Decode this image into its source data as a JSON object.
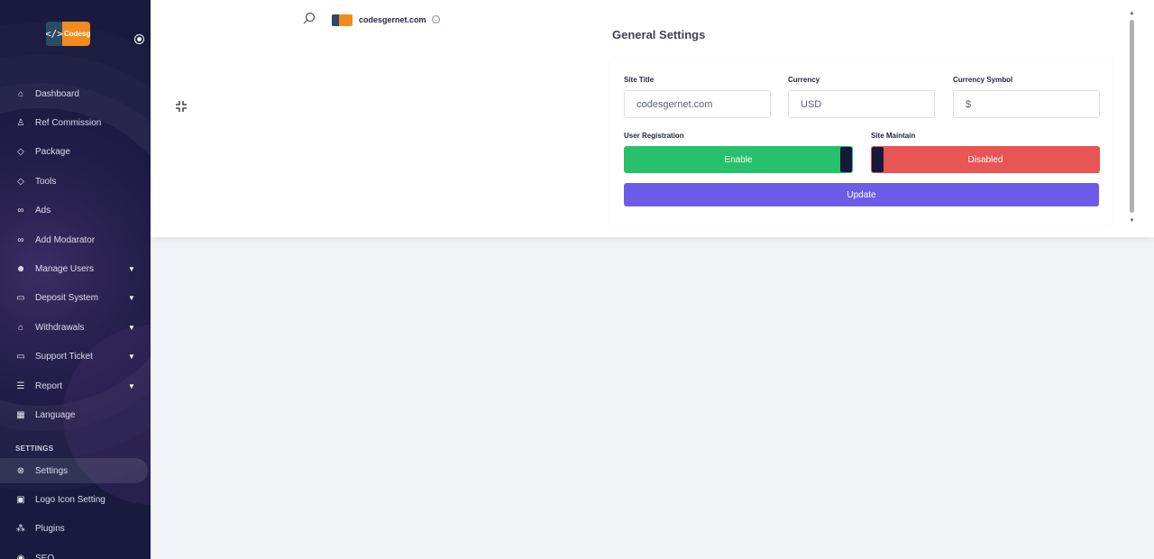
{
  "brand": {
    "logo_text": "Codesger",
    "logo_mark": "</>"
  },
  "sidebar": {
    "items": [
      {
        "label": "Dashboard",
        "icon": "home-icon",
        "glyph": "⌂",
        "has_submenu": false
      },
      {
        "label": "Ref Commission",
        "icon": "bell-icon",
        "glyph": "♙",
        "has_submenu": false
      },
      {
        "label": "Package",
        "icon": "tag-icon",
        "glyph": "◇",
        "has_submenu": false
      },
      {
        "label": "Tools",
        "icon": "tag-icon",
        "glyph": "◇",
        "has_submenu": false
      },
      {
        "label": "Ads",
        "icon": "link-icon",
        "glyph": "∞",
        "has_submenu": false
      },
      {
        "label": "Add Modarator",
        "icon": "link-icon",
        "glyph": "∞",
        "has_submenu": false
      },
      {
        "label": "Manage Users",
        "icon": "users-icon",
        "glyph": "☻",
        "has_submenu": true
      },
      {
        "label": "Deposit System",
        "icon": "credit-card-icon",
        "glyph": "▭",
        "has_submenu": true
      },
      {
        "label": "Withdrawals",
        "icon": "bank-icon",
        "glyph": "⌂",
        "has_submenu": true
      },
      {
        "label": "Support Ticket",
        "icon": "ticket-icon",
        "glyph": "▭",
        "has_submenu": true
      },
      {
        "label": "Report",
        "icon": "list-icon",
        "glyph": "☰",
        "has_submenu": true
      },
      {
        "label": "Language",
        "icon": "language-icon",
        "glyph": "▦",
        "has_submenu": false
      }
    ],
    "section_title": "SETTINGS",
    "settings_items": [
      {
        "label": "Settings",
        "icon": "settings-icon",
        "glyph": "⊗",
        "active": true
      },
      {
        "label": "Logo Icon Setting",
        "icon": "image-icon",
        "glyph": "▣",
        "active": false
      },
      {
        "label": "Plugins",
        "icon": "plugins-icon",
        "glyph": "⁂",
        "active": false
      },
      {
        "label": "SEO",
        "icon": "seo-icon",
        "glyph": "◉",
        "active": false
      }
    ]
  },
  "header": {
    "site_name": "codesgernet.com",
    "chevron": "⌄"
  },
  "page": {
    "title": "General Settings"
  },
  "form": {
    "site_title": {
      "label": "Site Title",
      "value": "codesgernet.com"
    },
    "currency": {
      "label": "Currency",
      "value": "USD"
    },
    "currency_symbol": {
      "label": "Currency Symbol",
      "value": "$"
    },
    "user_registration": {
      "label": "User Registration",
      "state": "Enable",
      "color": "#27c06b"
    },
    "site_maintain": {
      "label": "Site Maintain",
      "state": "Disabled",
      "color": "#e95455"
    },
    "update_label": "Update"
  },
  "colors": {
    "accent": "#6c5ce7",
    "sidebar_bg": "#1b1a40",
    "logo_orange": "#f28b1e"
  }
}
